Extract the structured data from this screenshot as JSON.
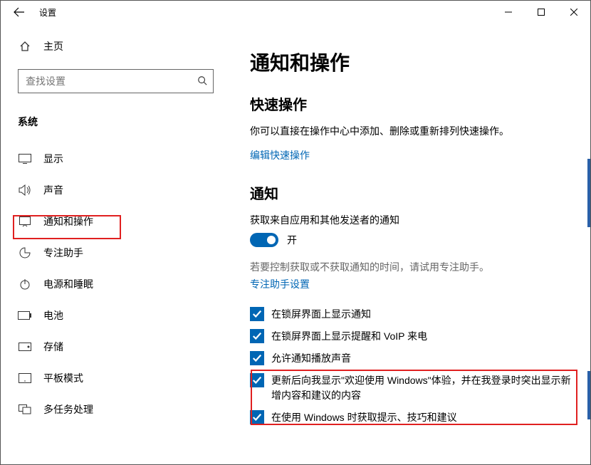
{
  "window": {
    "title": "设置"
  },
  "sidebar": {
    "home": "主页",
    "search_placeholder": "查找设置",
    "group": "系统",
    "items": [
      {
        "icon": "display",
        "label": "显示"
      },
      {
        "icon": "sound",
        "label": "声音"
      },
      {
        "icon": "notify",
        "label": "通知和操作"
      },
      {
        "icon": "focus",
        "label": "专注助手"
      },
      {
        "icon": "power",
        "label": "电源和睡眠"
      },
      {
        "icon": "battery",
        "label": "电池"
      },
      {
        "icon": "storage",
        "label": "存储"
      },
      {
        "icon": "tablet",
        "label": "平板模式"
      },
      {
        "icon": "multitask",
        "label": "多任务处理"
      }
    ]
  },
  "main": {
    "title": "通知和操作",
    "quick_title": "快速操作",
    "quick_desc": "你可以直接在操作中心中添加、删除或重新排列快速操作。",
    "edit_quick": "编辑快速操作",
    "notify_title": "通知",
    "notify_sub": "获取来自应用和其他发送者的通知",
    "toggle_on": "开",
    "focus_note": "若要控制获取或不获取通知的时间，请试用专注助手。",
    "focus_link": "专注助手设置",
    "check1": "在锁屏界面上显示通知",
    "check2": "在锁屏界面上显示提醒和 VoIP 来电",
    "check3": "允许通知播放声音",
    "check4": "更新后向我显示\"欢迎使用 Windows\"体验，并在我登录时突出显示新增内容和建议的内容",
    "check5": "在使用 Windows 时获取提示、技巧和建议"
  }
}
